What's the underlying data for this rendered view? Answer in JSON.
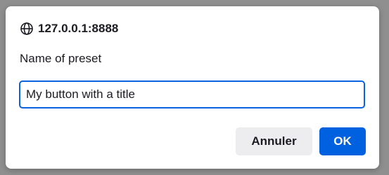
{
  "dialog": {
    "origin": "127.0.0.1:8888",
    "origin_icon": "globe-icon",
    "message": "Name of preset",
    "input": {
      "value": "My button with a title"
    },
    "buttons": {
      "cancel_label": "Annuler",
      "ok_label": "OK"
    }
  },
  "colors": {
    "overlay": "#8f8f8f",
    "accent": "#0061e0",
    "input_border": "#0b61e4",
    "secondary_button": "#ededf0"
  }
}
